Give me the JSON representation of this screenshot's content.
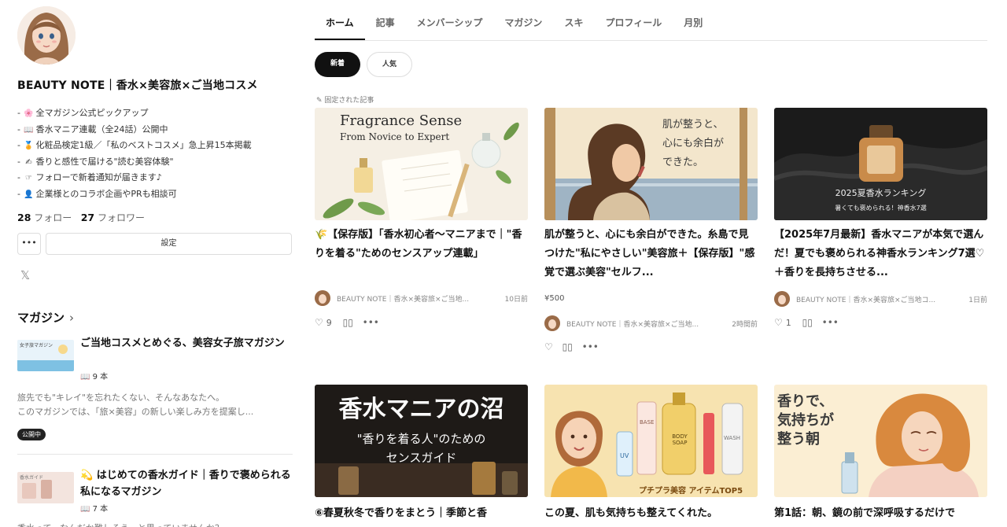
{
  "profile": {
    "blog_title": "BEAUTY NOTE｜香水×美容旅×ご当地コスメ",
    "bio": [
      {
        "icon": "🌸",
        "text": "全マガジン公式ピックアップ"
      },
      {
        "icon": "📖",
        "text": "香水マニア連載（全24話）公開中"
      },
      {
        "icon": "🏅",
        "text": "化粧品検定1級／「私のベストコスメ」急上昇15本掲載"
      },
      {
        "icon": "✍",
        "text": "香りと感性で届ける\"読む美容体験\""
      },
      {
        "icon": "☞",
        "text": "フォローで新着通知が届きます♪"
      },
      {
        "icon": "👤",
        "text": "企業様とのコラボ企画やPRも相談可"
      }
    ],
    "follow_count": "28",
    "follow_label": "フォロー",
    "follower_count": "27",
    "follower_label": "フォロワー",
    "more_label": "•••",
    "settings_label": "設定",
    "x_icon": "𝕏"
  },
  "magazines": {
    "heading": "マガジン",
    "chevron": "›",
    "items": [
      {
        "thumb_text": "女子旅マガジン",
        "title": "ご当地コスメとめぐる、美容女子旅マガジン",
        "count": "📖 9 本",
        "desc1": "旅先でも\"キレイ\"を忘れたくない、そんなあなたへ。",
        "desc2": "このマガジンでは、「旅×美容」の新しい楽しみ方を提案し...",
        "badge": "公開中"
      },
      {
        "thumb_text": "香水ガイド",
        "title": "💫 はじめての香水ガイド｜香りで褒められる私になるマガジン",
        "count": "📖 7 本",
        "desc1": "香水って、なんだか難しそう…と思っていませんか？"
      }
    ]
  },
  "tabs": [
    "ホーム",
    "記事",
    "メンバーシップ",
    "マガジン",
    "スキ",
    "プロフィール",
    "月別"
  ],
  "filters": {
    "new": "新着",
    "popular": "人気"
  },
  "pinned_label": "✎ 固定された記事",
  "articles": [
    {
      "thumb_line1": "Fragrance Sense",
      "thumb_line2": "From Novice to Expert",
      "title": "🌾【保存版】「香水初心者〜マニアまで｜\"香りを着る\"ためのセンスアップ連載」",
      "author": "BEAUTY NOTE｜香水×美容旅×ご当地...",
      "time": "10日前",
      "likes": "9",
      "like_icon": "♡",
      "magazine_icon": "▯▯",
      "more_icon": "•••"
    },
    {
      "thumb_line1": "肌が整うと、",
      "thumb_line2": "心にも余白が",
      "thumb_line3": "できた。",
      "title": "肌が整うと、心にも余白ができた。糸島で見つけた\"私にやさしい\"美容旅＋【保存版】\"感覚で選ぶ美容\"セルフ...",
      "price": "¥500",
      "author": "BEAUTY NOTE｜香水×美容旅×ご当地...",
      "time": "2時間前",
      "like_icon": "♡",
      "magazine_icon": "▯▯",
      "more_icon": "•••"
    },
    {
      "thumb_line1": "2025夏香水ランキング",
      "thumb_line2": "暑くても褒められる！神香水7選",
      "title": "【2025年7月最新】香水マニアが本気で選んだ！夏でも褒められる神香水ランキング7選♡＋香りを長持ちさせる...",
      "author": "BEAUTY NOTE｜香水×美容旅×ご当地コ...",
      "time": "1日前",
      "likes": "1",
      "like_icon": "♡",
      "magazine_icon": "▯▯",
      "more_icon": "•••"
    },
    {
      "thumb_line1": "香水マニアの沼",
      "thumb_line2": "\"香りを着る人\"のための",
      "thumb_line3": "センスガイド",
      "title": "⑥春夏秋冬で香りをまとう｜季節と香"
    },
    {
      "thumb_line1": "プチプラ美容 アイテムTOP5",
      "bottle_labels": [
        "UV",
        "BASE",
        "BODY SOAP",
        "WASH"
      ],
      "title": "この夏、肌も気持ちも整えてくれた。"
    },
    {
      "thumb_line1": "香りで、",
      "thumb_line2": "気持ちが",
      "thumb_line3": "整う朝",
      "title": "第1話：朝、鏡の前で深呼吸するだけで"
    }
  ]
}
